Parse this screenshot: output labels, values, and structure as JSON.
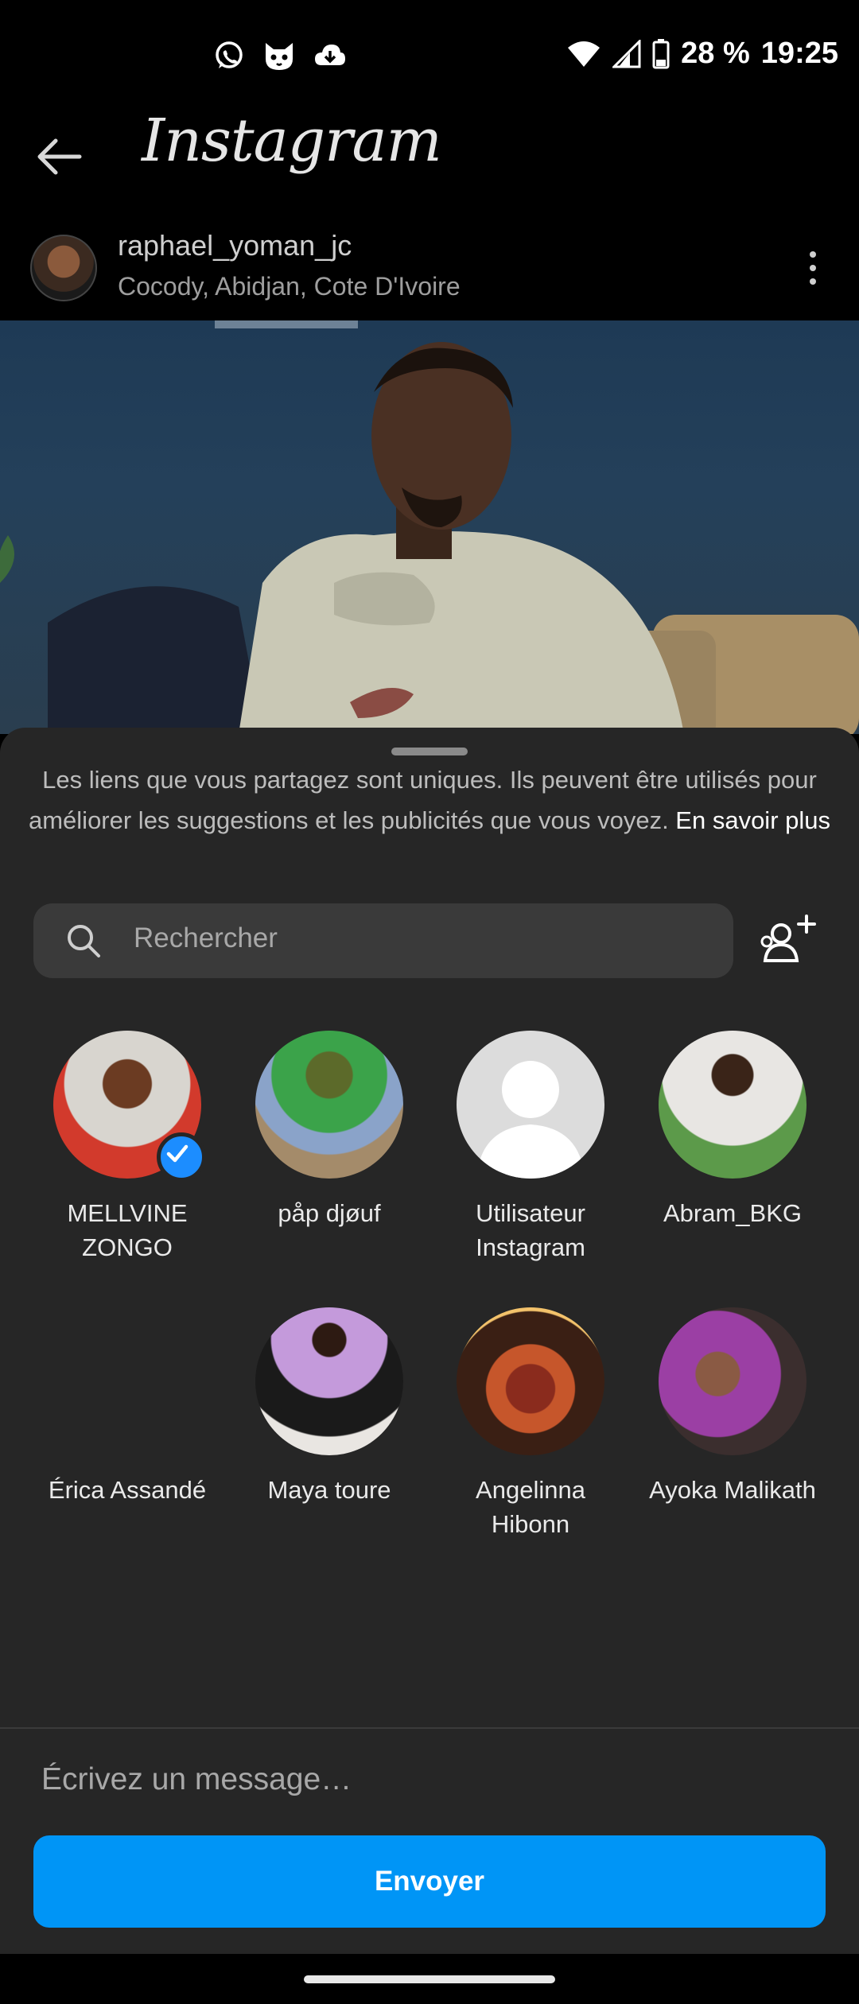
{
  "status_bar": {
    "battery_text": "28 %",
    "time": "19:25",
    "left_icons": [
      "whatsapp-icon",
      "cat-app-icon",
      "cloud-download-icon"
    ],
    "right_icons": [
      "wifi-icon",
      "signal-icon",
      "battery-icon"
    ]
  },
  "header": {
    "app_title": "Instagram",
    "back_icon": "arrow-left-icon"
  },
  "post": {
    "username": "raphael_yoman_jc",
    "location": "Cocody, Abidjan, Cote D'Ivoire",
    "more_icon": "kebab-menu-icon"
  },
  "share_sheet": {
    "notice_text": "Les liens que vous partagez sont uniques. Ils peuvent être utilisés pour améliorer les suggestions et les publicités que vous voyez. ",
    "notice_link": "En savoir plus",
    "search": {
      "placeholder": "Rechercher"
    },
    "add_people_icon": "add-people-icon",
    "contacts": [
      {
        "name": "MELLVINE ZONGO",
        "selected": true
      },
      {
        "name": "påp djøuf",
        "selected": false
      },
      {
        "name": "Utilisateur Instagram",
        "selected": false
      },
      {
        "name": "Abram_BKG",
        "selected": false
      },
      {
        "name": "Érica Assandé",
        "selected": false
      },
      {
        "name": "Maya toure",
        "selected": false
      },
      {
        "name": "Angelinna Hibonn",
        "selected": false
      },
      {
        "name": "Ayoka Malikath",
        "selected": false
      }
    ],
    "message_placeholder": "Écrivez un message…",
    "send_label": "Envoyer"
  },
  "colors": {
    "accent": "#0095f6",
    "sheet_bg": "#262626",
    "check": "#1c8dff"
  }
}
